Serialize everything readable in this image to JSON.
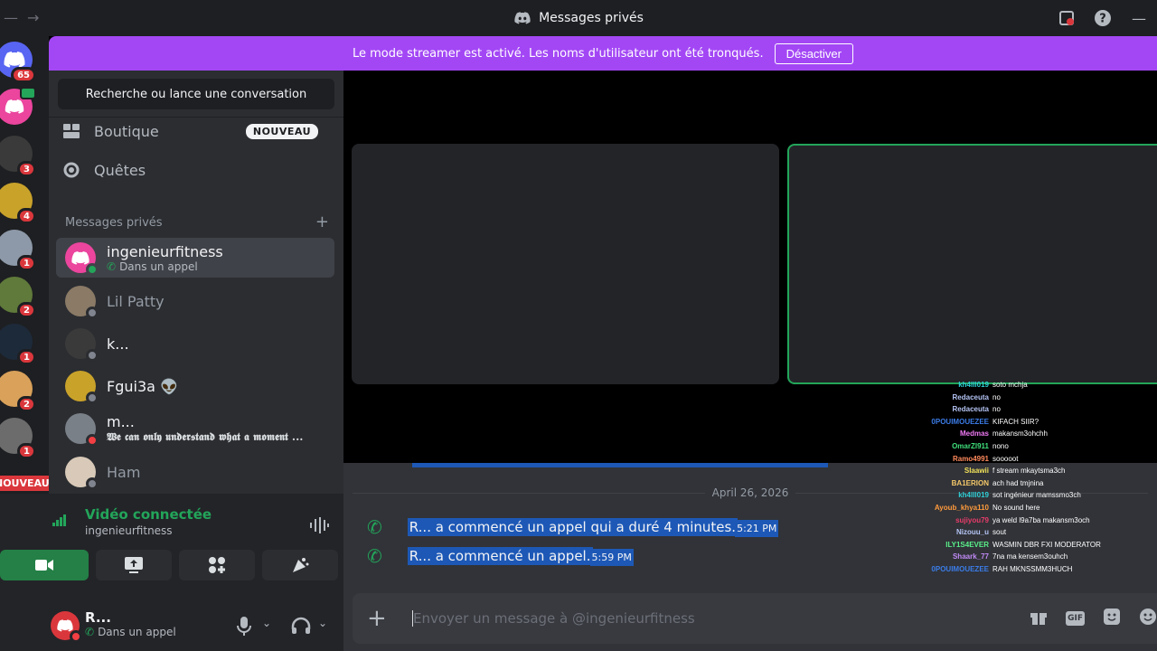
{
  "titlebar": {
    "title": "Messages privés",
    "back_icon": "arrow-left-icon",
    "forward_icon": "arrow-right-icon"
  },
  "banner": {
    "text": "Le mode streamer est activé. Les noms d'utilisateur ont été tronqués.",
    "button_label": "Désactiver"
  },
  "guilds": {
    "home_badge": "65",
    "items": [
      {
        "badge": "3"
      },
      {
        "badge": "4"
      },
      {
        "badge": "1"
      },
      {
        "badge": "2"
      },
      {
        "badge": "1"
      },
      {
        "badge": "2"
      },
      {
        "badge": "1"
      },
      {
        "badge": "5",
        "label": "NOUVEAU"
      }
    ]
  },
  "sidebar": {
    "search_placeholder": "Recherche ou lance une conversation",
    "shop_label": "Boutique",
    "shop_badge": "NOUVEAU",
    "quests_label": "Quêtes",
    "dm_header": "Messages privés",
    "dm_add": "+",
    "dms": [
      {
        "name": "ingenieurfitness",
        "sub": "Dans un appel",
        "status": "online"
      },
      {
        "name": "Lil Patty",
        "sub": "",
        "status": "offline"
      },
      {
        "name": "k...",
        "sub": "",
        "status": "offline"
      },
      {
        "name": "Fgui3a",
        "emoji": "👽",
        "sub": "",
        "status": "offline"
      },
      {
        "name": "m...",
        "sub": "𝖂𝖊 𝖈𝖆𝖓 𝖔𝖓𝖑𝖞 𝖚𝖓𝖉𝖊𝖗𝖘𝖙𝖆𝖓𝖉 𝖜𝖍𝖆𝖙 𝖆 𝖒𝖔𝖒𝖊𝖓𝖙 ...",
        "status": "dnd"
      },
      {
        "name": "Ham",
        "sub": "",
        "status": "offline"
      }
    ]
  },
  "voice": {
    "title": "Vidéo connectée",
    "channel": "ingenieurfitness"
  },
  "user": {
    "name": "R...",
    "status": "Dans un appel"
  },
  "chat": {
    "date": "April 26, 2026",
    "messages": [
      {
        "text": "R... a commencé un appel qui a duré 4 minutes.",
        "time": "5:21 PM"
      },
      {
        "text": "R... a commencé un appel.",
        "time": "5:59 PM"
      }
    ],
    "input_placeholder": "Envoyer un message à @ingenieurfitness"
  },
  "stream_chat": [
    {
      "user": "kh4lll019",
      "msg": "soto mchja",
      "color": "#2ecfd6"
    },
    {
      "user": "Redaceuta",
      "msg": "no",
      "color": "#b5c4f5"
    },
    {
      "user": "Redaceuta",
      "msg": "no",
      "color": "#b5c4f5"
    },
    {
      "user": "0POUIMOUEZEE",
      "msg": "KIFACH SIIR?",
      "color": "#3b7ce8"
    },
    {
      "user": "Medmas",
      "msg": "makansm3ohchh",
      "color": "#f07af5"
    },
    {
      "user": "OmarZl911",
      "msg": "nono",
      "color": "#3fe07c"
    },
    {
      "user": "Ramo4991",
      "msg": "sooooot",
      "color": "#ff8a5c"
    },
    {
      "user": "Slaawii",
      "msg": "f stream mkaytsma3ch",
      "color": "#f0e05a"
    },
    {
      "user": "BA1ERION",
      "msg": "ach had tmjnina",
      "color": "#f5c86a"
    },
    {
      "user": "kh4lll019",
      "msg": "sot ingénieur mamssmo3ch",
      "color": "#2ecfd6"
    },
    {
      "user": "Ayoub_khya110",
      "msg": "No sound here",
      "color": "#ff9a3c"
    },
    {
      "user": "sujiyou79",
      "msg": "ya weld l9a7ba makansm3och",
      "color": "#e83b6a"
    },
    {
      "user": "Nizouu_u",
      "msg": "sout",
      "color": "#b5c4f5"
    },
    {
      "user": "ILY1S4EVER",
      "msg": "WASMIN DBR FXI MODERATOR",
      "color": "#5af08a"
    },
    {
      "user": "Shaark_77",
      "msg": "7na ma kensem3ouhch",
      "color": "#c08af5"
    },
    {
      "user": "0POUIMOUEZEE",
      "msg": "RAH MKNSSMM3HUCH",
      "color": "#3b7ce8"
    }
  ]
}
